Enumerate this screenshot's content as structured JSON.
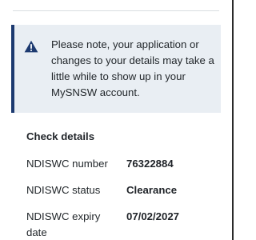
{
  "notice": {
    "icon": "warning-icon",
    "text": "Please note, your application or changes to your details may take a little while to show up in your MySNSW account."
  },
  "details": {
    "title": "Check details",
    "rows": [
      {
        "label": "NDISWC number",
        "value": "76322884"
      },
      {
        "label": "NDISWC status",
        "value": "Clearance"
      },
      {
        "label": "NDISWC expiry date",
        "value": "07/02/2027"
      }
    ]
  },
  "colors": {
    "notice_background": "#e9eef3",
    "notice_accent": "#1d3a70",
    "icon": "#1d3a70"
  }
}
